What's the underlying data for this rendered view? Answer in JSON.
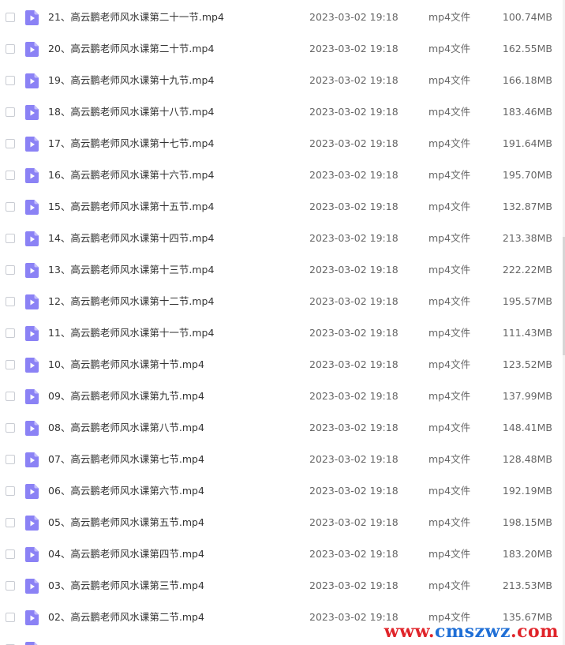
{
  "colors": {
    "icon_bg": "#8b82f5",
    "icon_fold": "#c4bffb",
    "watermark_red": "#e0242a",
    "watermark_blue": "#1f6fd6"
  },
  "file_icon": "video-file-icon",
  "files": [
    {
      "name": "21、高云鹏老师风水课第二十一节.mp4",
      "date": "2023-03-02 19:18",
      "type": "mp4文件",
      "size": "100.74MB"
    },
    {
      "name": "20、高云鹏老师风水课第二十节.mp4",
      "date": "2023-03-02 19:18",
      "type": "mp4文件",
      "size": "162.55MB"
    },
    {
      "name": "19、高云鹏老师风水课第十九节.mp4",
      "date": "2023-03-02 19:18",
      "type": "mp4文件",
      "size": "166.18MB"
    },
    {
      "name": "18、高云鹏老师风水课第十八节.mp4",
      "date": "2023-03-02 19:18",
      "type": "mp4文件",
      "size": "183.46MB"
    },
    {
      "name": "17、高云鹏老师风水课第十七节.mp4",
      "date": "2023-03-02 19:18",
      "type": "mp4文件",
      "size": "191.64MB"
    },
    {
      "name": "16、高云鹏老师风水课第十六节.mp4",
      "date": "2023-03-02 19:18",
      "type": "mp4文件",
      "size": "195.70MB"
    },
    {
      "name": "15、高云鹏老师风水课第十五节.mp4",
      "date": "2023-03-02 19:18",
      "type": "mp4文件",
      "size": "132.87MB"
    },
    {
      "name": "14、高云鹏老师风水课第十四节.mp4",
      "date": "2023-03-02 19:18",
      "type": "mp4文件",
      "size": "213.38MB"
    },
    {
      "name": "13、高云鹏老师风水课第十三节.mp4",
      "date": "2023-03-02 19:18",
      "type": "mp4文件",
      "size": "222.22MB"
    },
    {
      "name": "12、高云鹏老师风水课第十二节.mp4",
      "date": "2023-03-02 19:18",
      "type": "mp4文件",
      "size": "195.57MB"
    },
    {
      "name": "11、高云鹏老师风水课第十一节.mp4",
      "date": "2023-03-02 19:18",
      "type": "mp4文件",
      "size": "111.43MB"
    },
    {
      "name": "10、高云鹏老师风水课第十节.mp4",
      "date": "2023-03-02 19:18",
      "type": "mp4文件",
      "size": "123.52MB"
    },
    {
      "name": "09、高云鹏老师风水课第九节.mp4",
      "date": "2023-03-02 19:18",
      "type": "mp4文件",
      "size": "137.99MB"
    },
    {
      "name": "08、高云鹏老师风水课第八节.mp4",
      "date": "2023-03-02 19:18",
      "type": "mp4文件",
      "size": "148.41MB"
    },
    {
      "name": "07、高云鹏老师风水课第七节.mp4",
      "date": "2023-03-02 19:18",
      "type": "mp4文件",
      "size": "128.48MB"
    },
    {
      "name": "06、高云鹏老师风水课第六节.mp4",
      "date": "2023-03-02 19:18",
      "type": "mp4文件",
      "size": "192.19MB"
    },
    {
      "name": "05、高云鹏老师风水课第五节.mp4",
      "date": "2023-03-02 19:18",
      "type": "mp4文件",
      "size": "198.15MB"
    },
    {
      "name": "04、高云鹏老师风水课第四节.mp4",
      "date": "2023-03-02 19:18",
      "type": "mp4文件",
      "size": "183.20MB"
    },
    {
      "name": "03、高云鹏老师风水课第三节.mp4",
      "date": "2023-03-02 19:18",
      "type": "mp4文件",
      "size": "213.53MB"
    },
    {
      "name": "02、高云鹏老师风水课第二节.mp4",
      "date": "2023-03-02 19:18",
      "type": "mp4文件",
      "size": "135.67MB"
    }
  ],
  "watermark": {
    "part1": "www.",
    "part2": "cmszwz",
    "part3": ".com"
  }
}
